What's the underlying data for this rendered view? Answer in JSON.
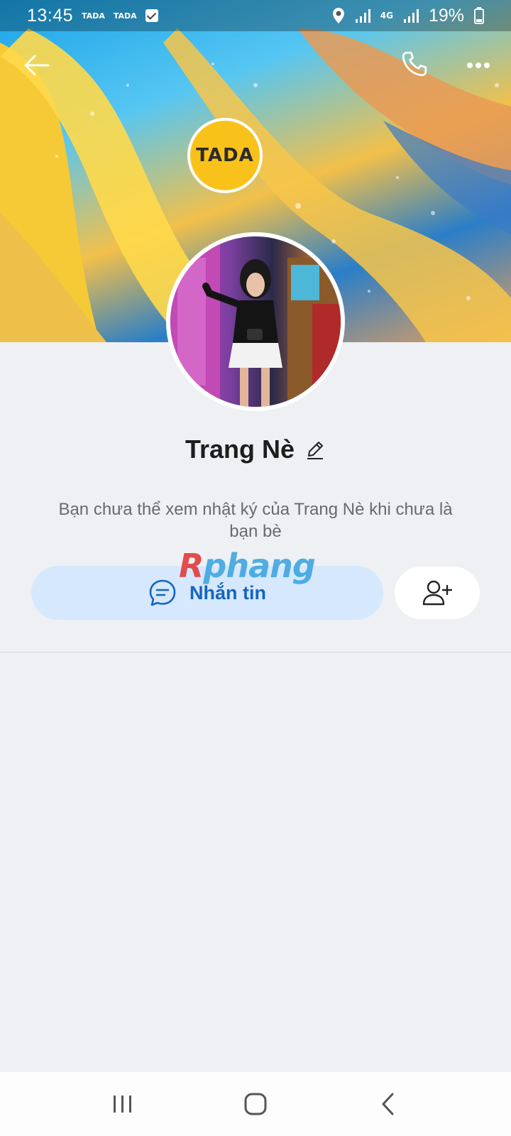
{
  "status_bar": {
    "time": "13:45",
    "notification_apps": [
      "TADA",
      "TADA"
    ],
    "network": "4G",
    "battery": "19%"
  },
  "header": {
    "back_icon": "arrow-left-icon",
    "call_icon": "phone-icon",
    "more_icon": "more-horizontal-icon"
  },
  "cover": {
    "brand_logo_text": "TADA"
  },
  "profile": {
    "name": "Trang Nè",
    "privacy_note": "Bạn chưa thể xem nhật ký của Trang Nè khi chưa là bạn bè"
  },
  "actions": {
    "message_label": "Nhắn tin",
    "message_icon": "chat-bubble-icon",
    "add_friend_icon": "add-user-icon"
  },
  "watermark": {
    "initial": "R",
    "rest": "phang"
  },
  "colors": {
    "accent": "#1565c0",
    "message_bg": "#d6e8fd",
    "page_bg": "#eff0f4",
    "logo_yellow": "#f9c21a"
  },
  "nav_bar": {
    "icons": [
      "recent-apps-icon",
      "home-icon",
      "back-icon"
    ]
  }
}
